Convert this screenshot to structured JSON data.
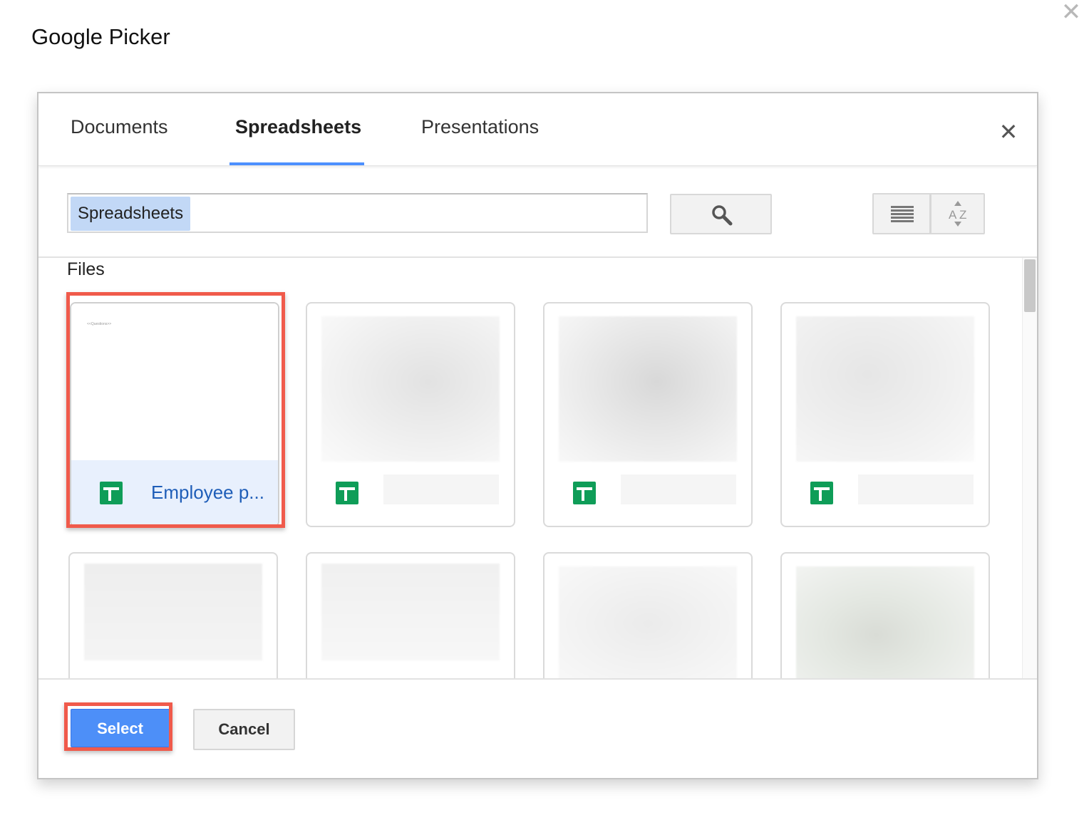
{
  "window": {
    "title": "Google Picker",
    "close_icon": "✕"
  },
  "tabs": [
    {
      "label": "Documents",
      "active": false
    },
    {
      "label": "Spreadsheets",
      "active": true
    },
    {
      "label": "Presentations",
      "active": false
    }
  ],
  "tabs_close_icon": "✕",
  "search": {
    "query_chip": "Spreadsheets"
  },
  "section": {
    "label": "Files"
  },
  "files": [
    {
      "name": "Employee p...",
      "preview_text": "<<Questions>>",
      "selected": true
    },
    {
      "name": "",
      "selected": false
    },
    {
      "name": "",
      "selected": false
    },
    {
      "name": "",
      "selected": false
    },
    {
      "name": "",
      "selected": false
    },
    {
      "name": "",
      "selected": false
    },
    {
      "name": "",
      "selected": false
    },
    {
      "name": "",
      "selected": false
    }
  ],
  "footer": {
    "select_label": "Select",
    "cancel_label": "Cancel"
  },
  "colors": {
    "accent": "#4d90fe",
    "highlight": "#f05a4b",
    "sheets_green": "#0f9d58"
  }
}
